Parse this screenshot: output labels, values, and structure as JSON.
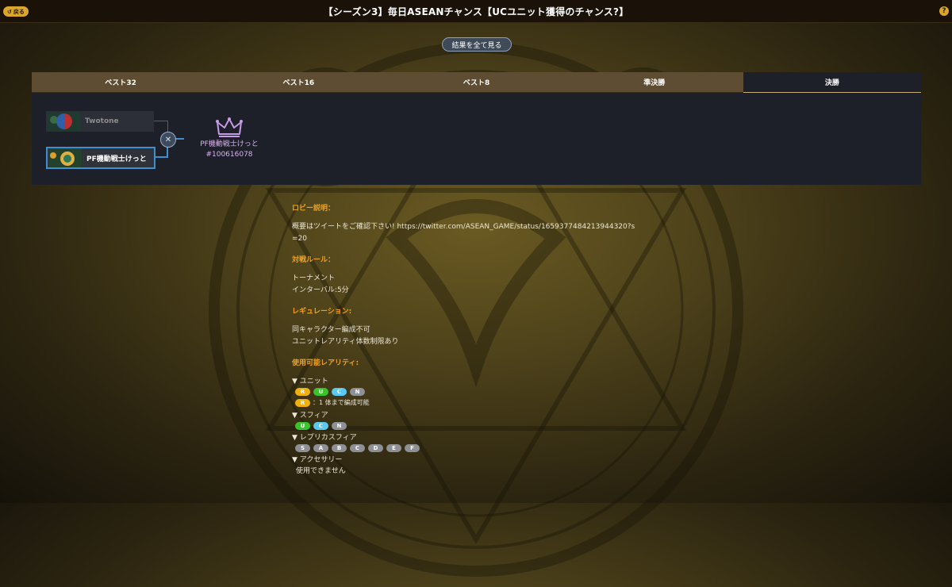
{
  "header": {
    "title": "【シーズン3】毎日ASEANチャンス【UCユニット獲得のチャンス?】",
    "back_label": "戻る",
    "help_label": "?"
  },
  "results_button": "結果を全て見る",
  "tabs": [
    {
      "label": "ベスト32",
      "active": false
    },
    {
      "label": "ベスト16",
      "active": false
    },
    {
      "label": "ベスト8",
      "active": false
    },
    {
      "label": "準決勝",
      "active": false
    },
    {
      "label": "決勝",
      "active": true
    }
  ],
  "bracket": {
    "loser_name": "Twotone",
    "winner_name": "PF機動戦士けっと",
    "champion_name": "PF機動戦士けっと",
    "champion_id": "#100616078"
  },
  "info": {
    "lobby_heading": "ロビー説明：",
    "lobby_text_1": "概要はツイートをご確認下さい! https://twitter.com/ASEAN_GAME/status/1659377484213944320?s",
    "lobby_text_2": "=20",
    "rules_heading": "対戦ルール：",
    "rules_1": "トーナメント",
    "rules_2": "インターバル:5分",
    "regulation_heading": "レギュレーション:",
    "regulation_1": "同キャラクター編成不可",
    "regulation_2": "ユニットレアリティ体数制限あり",
    "rarity_heading": "使用可能レアリティ:",
    "unit_label": "ユニット",
    "unit_badges": [
      "R",
      "U",
      "C",
      "N"
    ],
    "unit_note_badge": "R",
    "unit_note": "：1 体まで編成可能",
    "sphere_label": "スフィア",
    "sphere_badges": [
      "U",
      "C",
      "N"
    ],
    "replica_label": "レプリカスフィア",
    "replica_badges": [
      "S",
      "A",
      "B",
      "C",
      "D",
      "E",
      "F"
    ],
    "accessory_label": "アクセサリー",
    "accessory_text": "使用できません"
  }
}
